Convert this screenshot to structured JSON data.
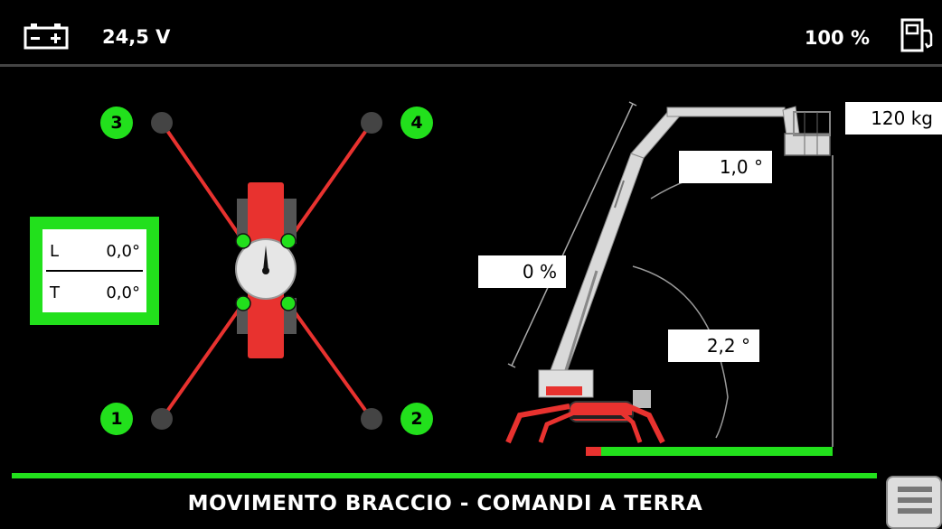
{
  "header": {
    "voltage": "24,5 V",
    "fuel_percent": "100 %",
    "battery_icon": "battery-icon",
    "fuel_icon": "fuel-pump-icon"
  },
  "inclinometer": {
    "l_label": "L",
    "l_value": "0,0°",
    "t_label": "T",
    "t_value": "0,0°"
  },
  "outriggers": {
    "labels": [
      "1",
      "2",
      "3",
      "4"
    ],
    "status_color": "#22e01c"
  },
  "boom": {
    "load": "120 kg",
    "jib_angle": "1,0 °",
    "extension": "0 %",
    "boom_angle": "2,2 °"
  },
  "footer": {
    "mode": "MOVIMENTO BRACCIO - COMANDI A TERRA",
    "menu_icon": "menu-icon"
  },
  "colors": {
    "accent_green": "#22e01c",
    "machine_red": "#e8322f",
    "background": "#000000"
  }
}
